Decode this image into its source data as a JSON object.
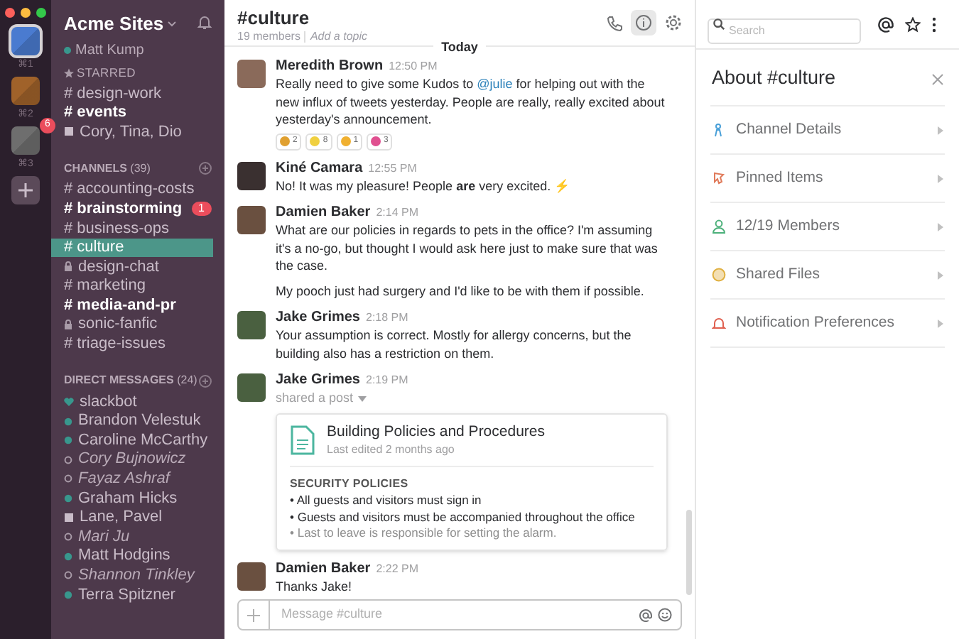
{
  "teams": [
    {
      "shortcut": "⌘1",
      "color": "#4a7bd0",
      "selected": true
    },
    {
      "shortcut": "⌘2",
      "color": "#a0622a",
      "selected": false
    },
    {
      "shortcut": "⌘3",
      "color": "#6e6e6e",
      "selected": false,
      "badge": "6"
    }
  ],
  "workspace": {
    "name": "Acme Sites",
    "user": "Matt Kump"
  },
  "starred": {
    "heading": "STARRED",
    "items": [
      {
        "kind": "channel",
        "name": "# design-work",
        "unread": false
      },
      {
        "kind": "channel",
        "name": "# events",
        "unread": true
      },
      {
        "kind": "group",
        "name": "Cory, Tina, Dio",
        "unread": false
      }
    ]
  },
  "channels": {
    "heading": "CHANNELS",
    "count": "(39)",
    "items": [
      {
        "kind": "public",
        "name": "# accounting-costs",
        "unread": false,
        "selected": false
      },
      {
        "kind": "public",
        "name": "# brainstorming",
        "unread": true,
        "selected": false,
        "badge": "1"
      },
      {
        "kind": "public",
        "name": "# business-ops",
        "unread": false,
        "selected": false
      },
      {
        "kind": "public",
        "name": "# culture",
        "unread": false,
        "selected": true
      },
      {
        "kind": "private",
        "name": "design-chat",
        "unread": false,
        "selected": false
      },
      {
        "kind": "public",
        "name": "# marketing",
        "unread": false,
        "selected": false
      },
      {
        "kind": "public",
        "name": "# media-and-pr",
        "unread": true,
        "selected": false
      },
      {
        "kind": "private",
        "name": "sonic-fanfic",
        "unread": false,
        "selected": false
      },
      {
        "kind": "public",
        "name": "# triage-issues",
        "unread": false,
        "selected": false
      }
    ]
  },
  "direct_messages": {
    "heading": "DIRECT MESSAGES",
    "count": "(24)",
    "items": [
      {
        "name": "slackbot",
        "kind": "bot"
      },
      {
        "name": "Brandon Velestuk",
        "kind": "online"
      },
      {
        "name": "Caroline McCarthy",
        "kind": "online"
      },
      {
        "name": "Cory Bujnowicz",
        "kind": "away"
      },
      {
        "name": "Fayaz Ashraf",
        "kind": "away"
      },
      {
        "name": "Graham Hicks",
        "kind": "online"
      },
      {
        "name": "Lane, Pavel",
        "kind": "group"
      },
      {
        "name": "Mari Ju",
        "kind": "away"
      },
      {
        "name": "Matt Hodgins",
        "kind": "online"
      },
      {
        "name": "Shannon Tinkley",
        "kind": "away"
      },
      {
        "name": "Terra Spitzner",
        "kind": "online"
      }
    ]
  },
  "channel_header": {
    "title": "#culture",
    "members": "19 members",
    "topic": "Add a topic",
    "info_selected": true
  },
  "date_divider": "Today",
  "messages": [
    {
      "author": "Meredith Brown",
      "time": "12:50 PM",
      "color": "#8a6a5a",
      "paragraphs": [
        [
          {
            "kind": "plain",
            "text": "Really need to give some Kudos to "
          },
          {
            "kind": "mention",
            "text": "@julie"
          },
          {
            "kind": "plain",
            "text": " for helping out with the new influx of tweets yesterday. People are really, really excited about yesterday's announcement."
          }
        ]
      ],
      "reactions": [
        {
          "count": "2",
          "color": "#e0a030"
        },
        {
          "count": "8",
          "color": "#f0d040"
        },
        {
          "count": "1",
          "color": "#f0b030"
        },
        {
          "count": "3",
          "color": "#e05090"
        }
      ]
    },
    {
      "author": "Kiné Camara",
      "time": "12:55 PM",
      "color": "#3a3030",
      "paragraphs": [
        [
          {
            "kind": "plain",
            "text": "No! It was my pleasure! People **are** very excited. ⚡"
          }
        ]
      ]
    },
    {
      "author": "Damien Baker",
      "time": "2:14 PM",
      "color": "#6a5040",
      "paragraphs": [
        [
          {
            "kind": "plain",
            "text": "What are our policies in regards to pets in the office? I'm assuming it's a no-go, but thought I would ask here just to make sure that was the case."
          }
        ],
        [
          {
            "kind": "plain",
            "text": "My pooch just had surgery and I'd like to be with them if possible."
          }
        ]
      ]
    },
    {
      "author": "Jake Grimes",
      "time": "2:18 PM",
      "color": "#4a6040",
      "paragraphs": [
        [
          {
            "kind": "plain",
            "text": "Your assumption is correct. Mostly for allergy concerns, but the building also has a restriction on them."
          }
        ]
      ]
    },
    {
      "author": "Jake Grimes",
      "time": "2:19 PM",
      "color": "#4a6040",
      "action": "shared a post",
      "post": {
        "title": "Building Policies and Procedures",
        "subtitle": "Last edited 2 months ago",
        "section": "SECURITY POLICIES",
        "bullets": [
          {
            "text": "• All guests and visitors must sign in",
            "faded": false
          },
          {
            "text": "• Guests and visitors must be accompanied throughout the office",
            "faded": false
          },
          {
            "text": "• Last to leave is responsible for setting the alarm.",
            "faded": true
          }
        ]
      }
    },
    {
      "author": "Damien Baker",
      "time": "2:22 PM",
      "color": "#6a5040",
      "paragraphs": [
        [
          {
            "kind": "plain",
            "text": "Thanks Jake!"
          }
        ]
      ]
    }
  ],
  "composer": {
    "placeholder": "Message #culture"
  },
  "search": {
    "placeholder": "Search"
  },
  "details_panel": {
    "title": "About #culture",
    "items": [
      {
        "label": "Channel Details",
        "color": "#4aa0d8"
      },
      {
        "label": "Pinned Items",
        "color": "#e07a5a"
      },
      {
        "label": "12/19 Members",
        "color": "#4cb07a"
      },
      {
        "label": "Shared Files",
        "color": "#e0b040"
      },
      {
        "label": "Notification Preferences",
        "color": "#e06050"
      }
    ]
  }
}
